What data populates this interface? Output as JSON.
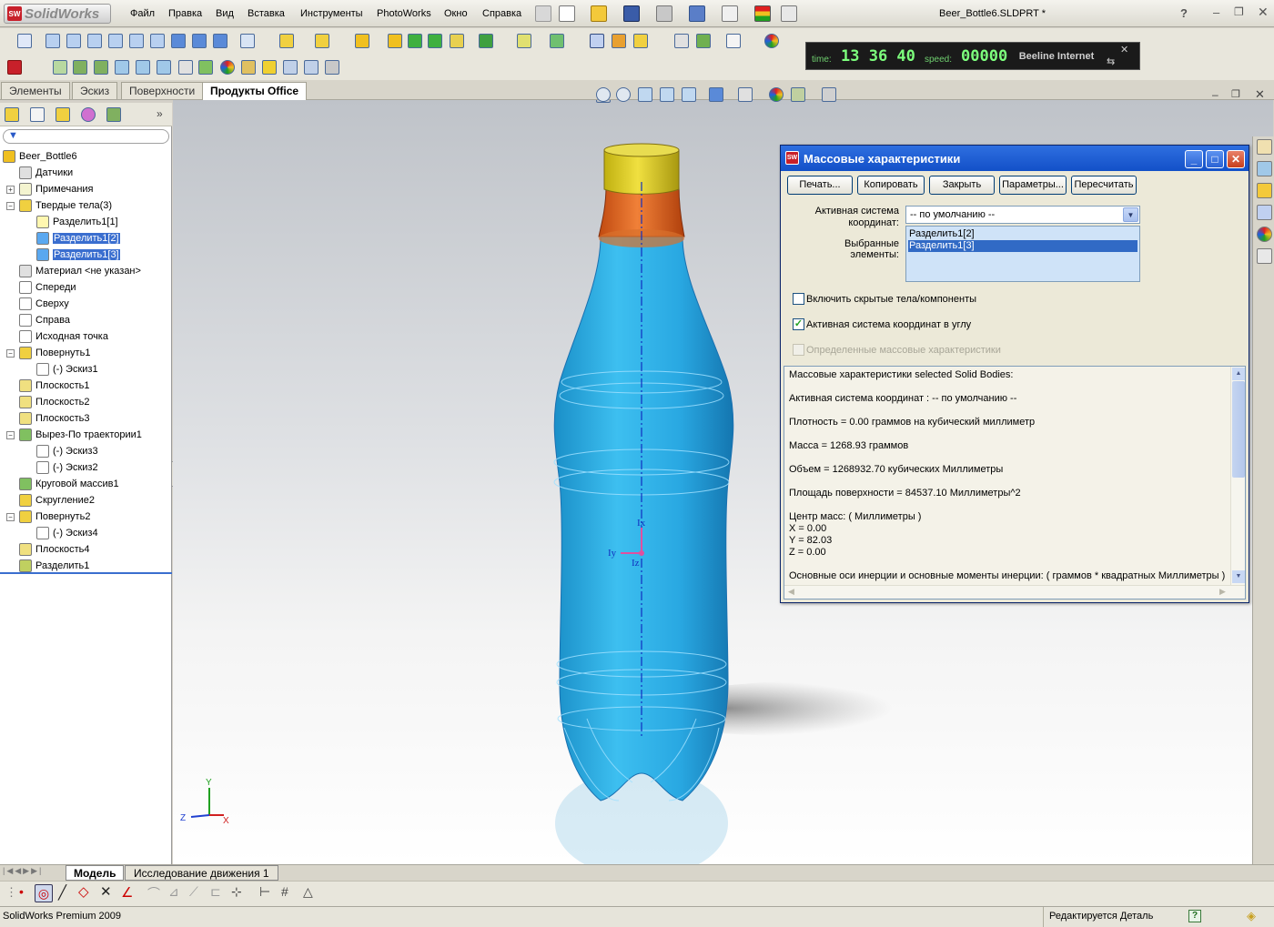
{
  "app": {
    "brand": "SolidWorks",
    "document_title": "Beer_Bottle6.SLDPRT *",
    "help_icon_label": "?"
  },
  "menu": {
    "items": [
      "Файл",
      "Правка",
      "Вид",
      "Вставка",
      "Инструменты",
      "PhotoWorks",
      "Окно",
      "Справка"
    ]
  },
  "network_widget": {
    "time_label": "time:",
    "time_value": "13 36 40",
    "speed_label": "speed:",
    "speed_value": "00000",
    "connection_name": "Beeline Internet"
  },
  "command_manager": {
    "tabs": [
      "Элементы",
      "Эскиз",
      "Поверхности",
      "Продукты Office"
    ],
    "active_tab": "Продукты Office"
  },
  "feature_tree": {
    "items": [
      {
        "label": "Beer_Bottle6",
        "indent": 0
      },
      {
        "label": "Датчики",
        "indent": 1
      },
      {
        "label": "Примечания",
        "indent": 1
      },
      {
        "label": "Твердые тела(3)",
        "indent": 1
      },
      {
        "label": "Разделить1[1]",
        "indent": 2
      },
      {
        "label": "Разделить1[2]",
        "indent": 2,
        "selected": true
      },
      {
        "label": "Разделить1[3]",
        "indent": 2,
        "selected": true
      },
      {
        "label": "Материал <не указан>",
        "indent": 1
      },
      {
        "label": "Спереди",
        "indent": 1
      },
      {
        "label": "Сверху",
        "indent": 1
      },
      {
        "label": "Справа",
        "indent": 1
      },
      {
        "label": "Исходная точка",
        "indent": 1
      },
      {
        "label": "Повернуть1",
        "indent": 1
      },
      {
        "label": "(-) Эскиз1",
        "indent": 2
      },
      {
        "label": "Плоскость1",
        "indent": 1
      },
      {
        "label": "Плоскость2",
        "indent": 1
      },
      {
        "label": "Плоскость3",
        "indent": 1
      },
      {
        "label": "Вырез-По траектории1",
        "indent": 1
      },
      {
        "label": "(-) Эскиз3",
        "indent": 2
      },
      {
        "label": "(-) Эскиз2",
        "indent": 2
      },
      {
        "label": "Круговой массив1",
        "indent": 1
      },
      {
        "label": "Скругление2",
        "indent": 1
      },
      {
        "label": "Повернуть2",
        "indent": 1
      },
      {
        "label": "(-) Эскиз4",
        "indent": 2
      },
      {
        "label": "Плоскость4",
        "indent": 1
      },
      {
        "label": "Разделить1",
        "indent": 1
      }
    ]
  },
  "triad": {
    "x_label": "Ix",
    "y_label": "Iy",
    "z_label": "Iz",
    "axis_y": "Y",
    "axis_z": "Z",
    "axis_x": "X"
  },
  "dialog": {
    "title": "Массовые характеристики",
    "buttons": [
      "Печать...",
      "Копировать",
      "Закрыть",
      "Параметры...",
      "Пересчитать"
    ],
    "coord_label_line1": "Активная система",
    "coord_label_line2": "координат:",
    "coord_value": "-- по умолчанию --",
    "selected_label": "Выбранные элементы:",
    "selected_items": [
      "Разделить1[2]",
      "Разделить1[3]"
    ],
    "checkbox_hidden": "Включить скрытые тела/компоненты",
    "checkbox_hidden_checked": false,
    "checkbox_corner": "Активная система координат в углу",
    "checkbox_corner_checked": true,
    "checkbox_defined": "Определенные массовые характеристики",
    "checkbox_defined_checked": false,
    "results": [
      "Массовые характеристики selected Solid Bodies:",
      "",
      "Активная система координат : -- по умолчанию --",
      "",
      "Плотность = 0.00 граммов на кубический миллиметр",
      "",
      "Масса = 1268.93 граммов",
      "",
      "Объем = 1268932.70 кубических Миллиметры",
      "",
      "Площадь поверхности = 84537.10 Миллиметры^2",
      "",
      "Центр масс: ( Миллиметры )",
      "      X = 0.00",
      "      Y = 82.03",
      "      Z = 0.00",
      "",
      "Основные оси инерции и основные моменты инерции: ( граммов * квадратных Миллиметры )"
    ]
  },
  "bottom_tabs": {
    "items": [
      "Модель",
      "Исследование движения 1"
    ],
    "active": "Модель"
  },
  "status": {
    "product": "SolidWorks Premium 2009",
    "state": "Редактируется Деталь"
  },
  "colors": {
    "bottle_body": "#2ab0e8",
    "bottle_neck": "#d7621a",
    "bottle_cap": "#e3d21a",
    "dialog_title": "#1f5fd8",
    "selection": "#3a6ecf"
  }
}
